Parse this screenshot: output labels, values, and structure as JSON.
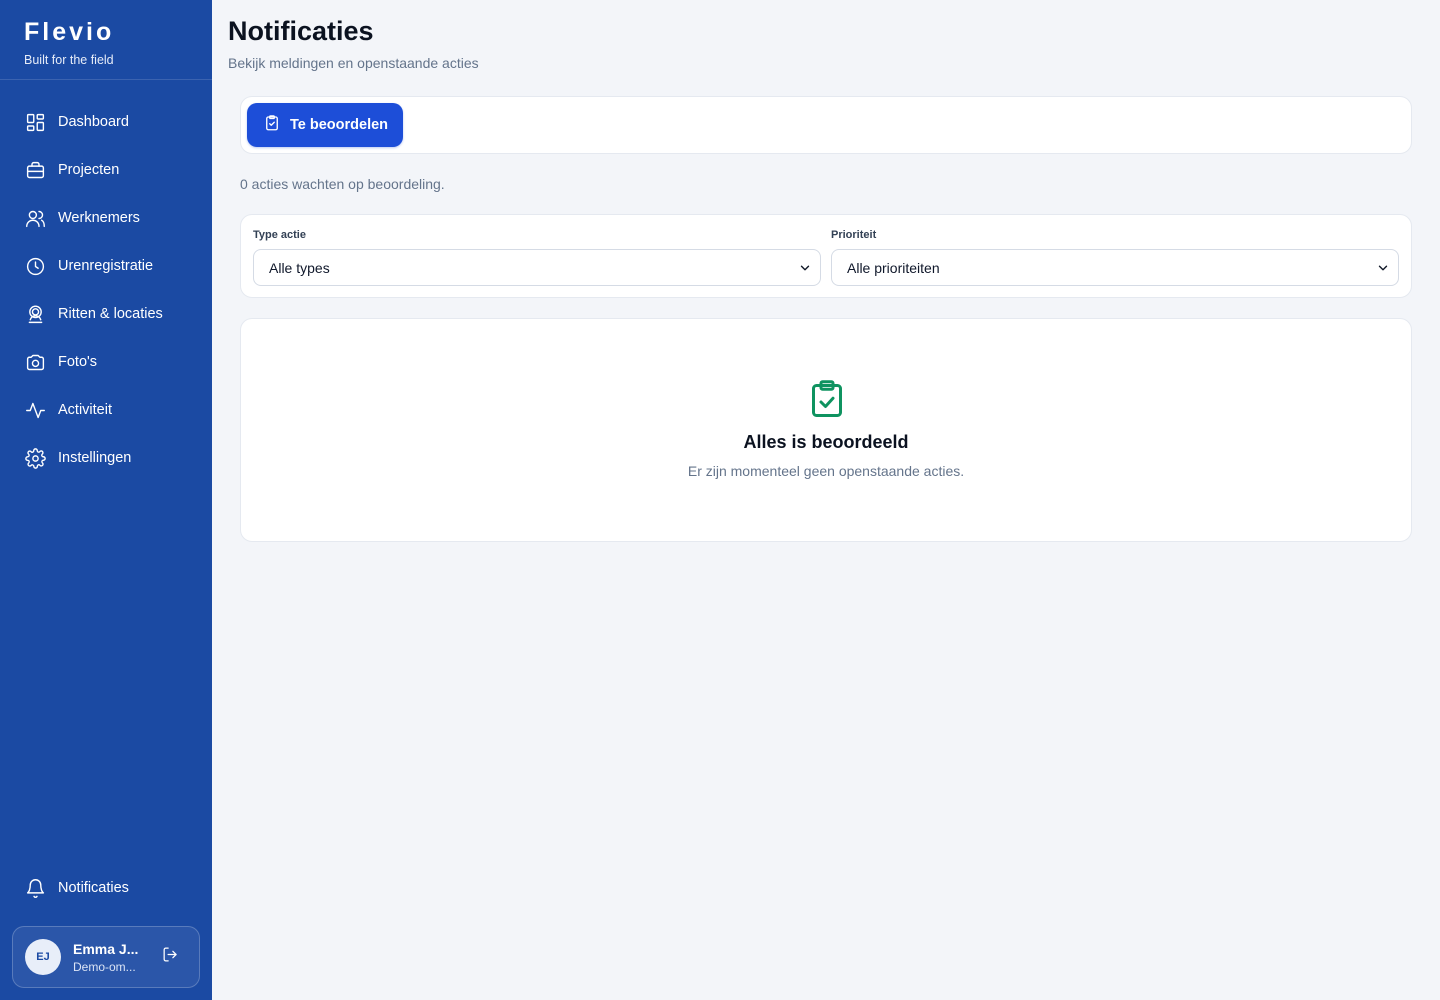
{
  "brand": {
    "name": "Flevio",
    "tagline": "Built for the field"
  },
  "sidebar": {
    "items": [
      {
        "label": "Dashboard",
        "icon": "dashboard-icon"
      },
      {
        "label": "Projecten",
        "icon": "briefcase-icon"
      },
      {
        "label": "Werknemers",
        "icon": "users-icon"
      },
      {
        "label": "Urenregistratie",
        "icon": "clock-icon"
      },
      {
        "label": "Ritten & locaties",
        "icon": "map-pin-user-icon"
      },
      {
        "label": "Foto's",
        "icon": "camera-icon"
      },
      {
        "label": "Activiteit",
        "icon": "activity-icon"
      },
      {
        "label": "Instellingen",
        "icon": "gear-icon"
      }
    ],
    "bottom_item": {
      "label": "Notificaties",
      "icon": "bell-icon"
    },
    "user": {
      "initials": "EJ",
      "name": "Emma J...",
      "org": "Demo-om..."
    }
  },
  "page": {
    "title": "Notificaties",
    "subtitle": "Bekijk meldingen en openstaande acties"
  },
  "tabs": [
    {
      "label": "Te beoordelen",
      "icon": "clipboard-check-icon",
      "active": true
    }
  ],
  "count_text": "0 acties wachten op beoordeling.",
  "filters": {
    "type": {
      "label": "Type actie",
      "value": "Alle types"
    },
    "priority": {
      "label": "Prioriteit",
      "value": "Alle prioriteiten"
    }
  },
  "empty_state": {
    "icon": "clipboard-check-icon",
    "title": "Alles is beoordeeld",
    "subtitle": "Er zijn momenteel geen openstaande acties."
  },
  "colors": {
    "sidebar": "#1b4aa3",
    "accent": "#1d4ed8",
    "success": "#0f9360",
    "background": "#f3f5f9"
  }
}
